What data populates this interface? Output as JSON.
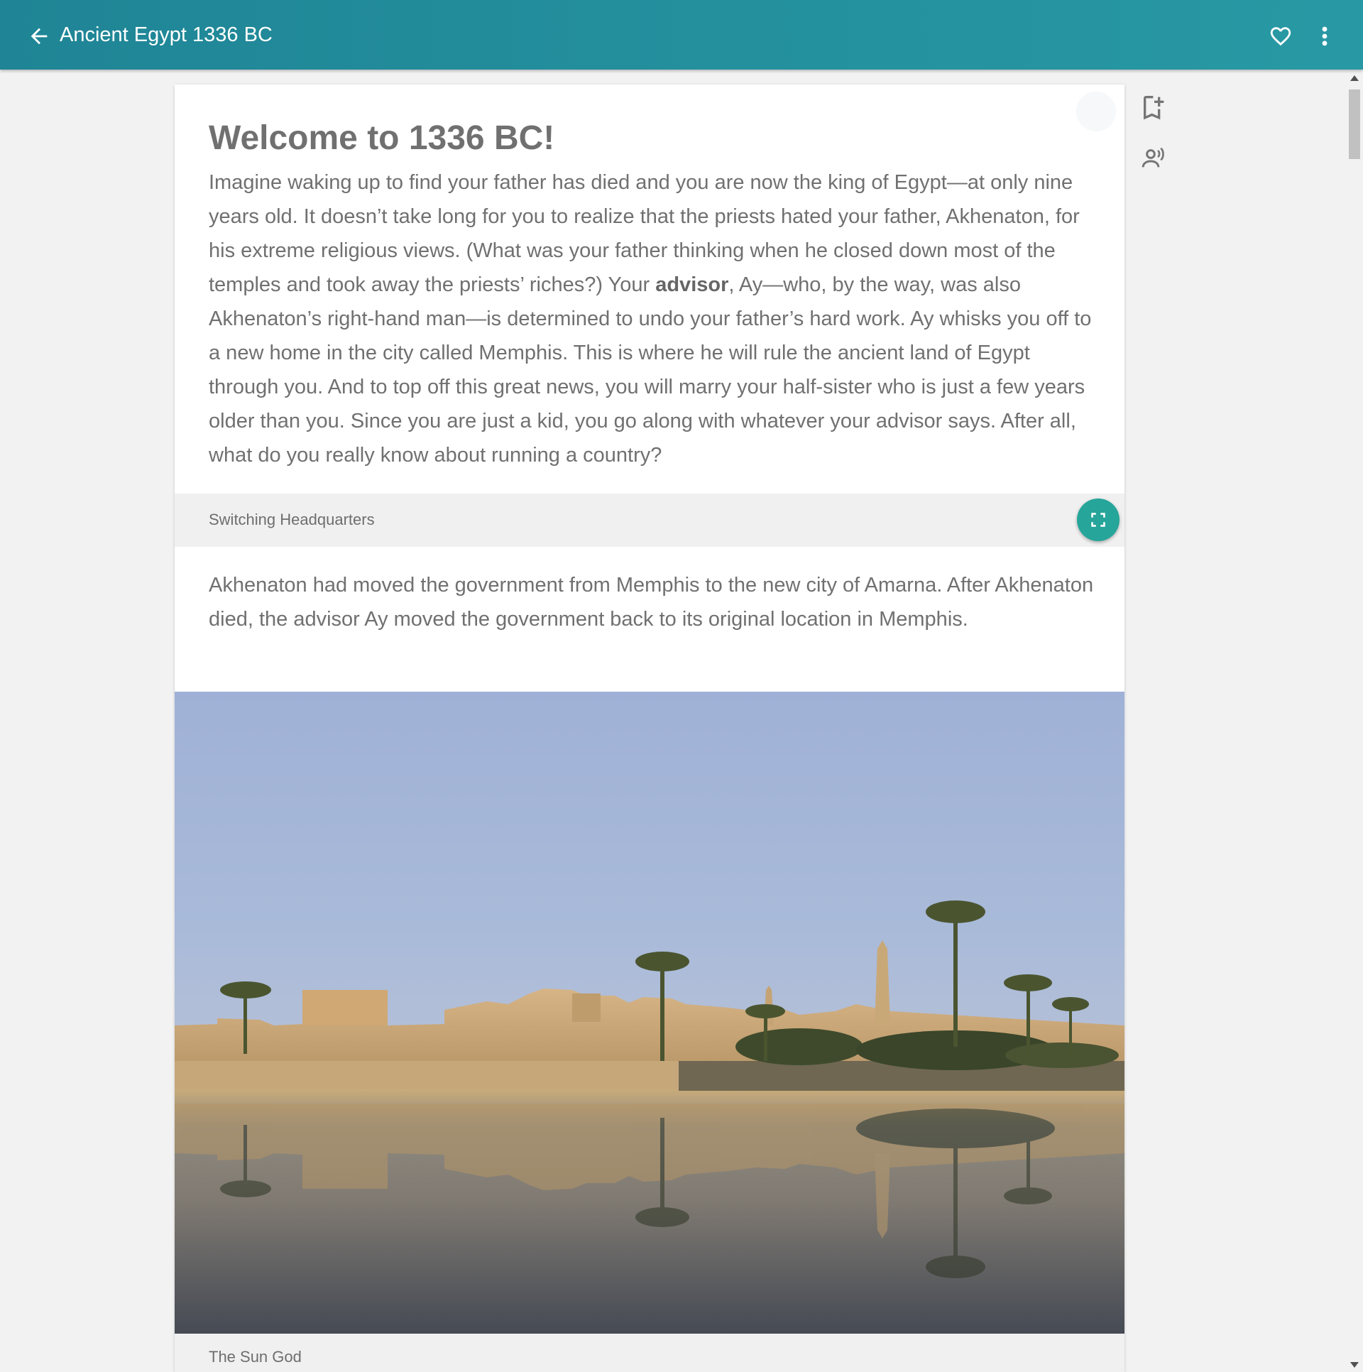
{
  "appbar": {
    "title": "Ancient Egypt 1336 BC",
    "back_icon": "arrow-left-icon",
    "favorite_icon": "heart-outline-icon",
    "menu_icon": "more-vert-icon",
    "color": "#2496a2"
  },
  "article": {
    "heading": "Welcome to 1336 BC!",
    "intro_before_bold": "Imagine waking up to find your father has died and you are now the king of Egypt—at only nine years old. It doesn’t take long for you to realize that the priests hated your father, Akhenaton, for his extreme religious views. (What was your father thinking when he closed down most of the temples and took away the priests’ riches?) Your ",
    "intro_bold": "advisor",
    "intro_after_bold": ", Ay—who, by the way, was also Akhenaton’s right-hand man—is determined to undo your father’s hard work. Ay whisks you off to a new home in the city called Memphis. This is where he will rule the ancient land of Egypt through you. And to top off this great news, you will marry your half-sister who is just a few years older than you. Since you are just a kid, you go along with whatever your advisor says. After all, what do you really know about running a country?",
    "sidebar_caption": "Switching Headquarters",
    "sidebar_text": "Akhenaton had moved the government from Memphis to the new city of Amarna. After Akhenaton died, the advisor Ay moved the government back to its original location in Memphis.",
    "photo_icon": "karnak-temple-photo",
    "next_caption": "The Sun God",
    "expand_icon": "fullscreen-icon",
    "accent_color": "#26a59a"
  },
  "side_tools": {
    "bookmark_icon": "bookmark-add-icon",
    "listen_icon": "text-to-speech-icon"
  }
}
